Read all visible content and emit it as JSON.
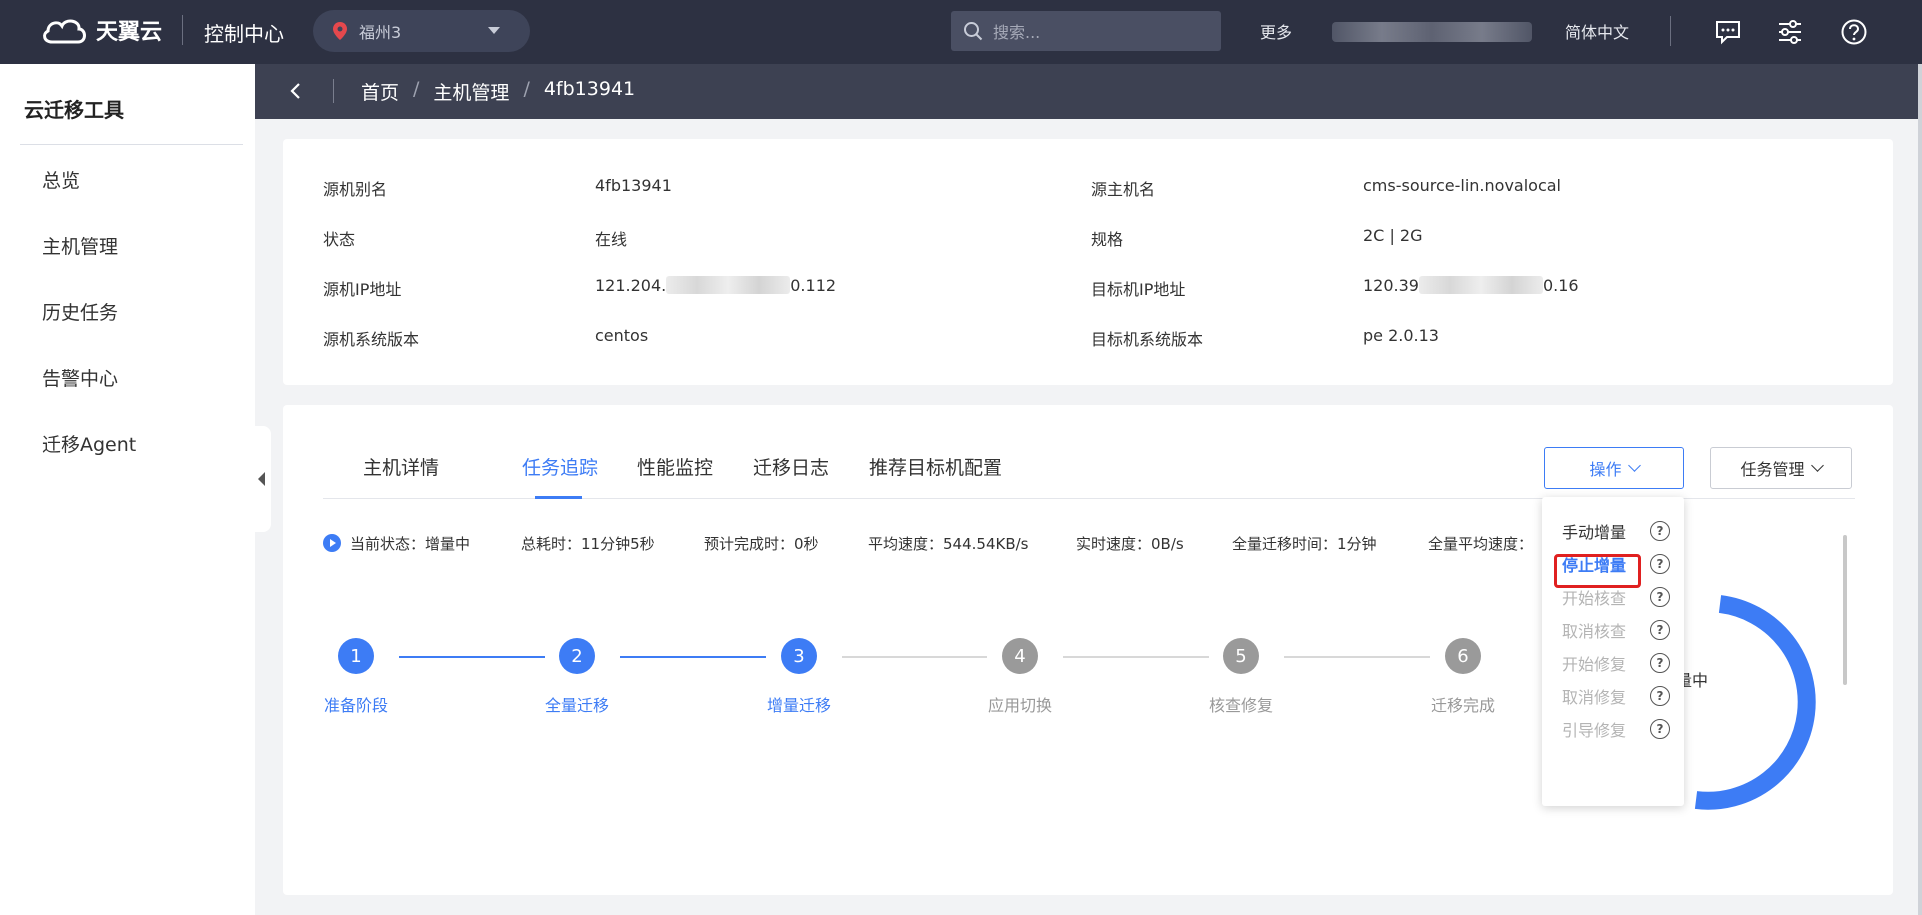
{
  "colors": {
    "accent": "#3d7cf5",
    "topbar": "#2d3142",
    "highlight_box": "#e02020"
  },
  "topbar": {
    "brand": "天翼云",
    "console": "控制中心",
    "region": "福州3",
    "search_placeholder": "搜索...",
    "more": "更多",
    "lang": "简体中文",
    "icons": [
      "message-icon",
      "settings-sliders-icon",
      "help-icon"
    ]
  },
  "sidebar": {
    "title": "云迁移工具",
    "items": [
      "总览",
      "主机管理",
      "历史任务",
      "告警中心",
      "迁移Agent"
    ]
  },
  "breadcrumb": {
    "items": [
      "首页",
      "主机管理",
      "4fb13941"
    ],
    "separator": "/"
  },
  "info": {
    "left": [
      {
        "label": "源机别名",
        "value": "4fb13941"
      },
      {
        "label": "状态",
        "value": "在线"
      },
      {
        "label": "源机IP地址",
        "value_prefix": "121.204.",
        "value_suffix": "0.112"
      },
      {
        "label": "源机系统版本",
        "value": "centos"
      }
    ],
    "right": [
      {
        "label": "源主机名",
        "value": "cms-source-lin.novalocal"
      },
      {
        "label": "规格",
        "value": "2C | 2G"
      },
      {
        "label": "目标机IP地址",
        "value_prefix": "120.39",
        "value_suffix": "0.16"
      },
      {
        "label": "目标机系统版本",
        "value": "pe 2.0.13"
      }
    ]
  },
  "tabs": [
    "主机详情",
    "任务追踪",
    "性能监控",
    "迁移日志",
    "推荐目标机配置"
  ],
  "active_tab": "任务追踪",
  "buttons": {
    "ops": "操作",
    "task": "任务管理"
  },
  "status": {
    "current": "当前状态：增量中",
    "total_time": "总耗时：11分钟5秒",
    "eta": "预计完成时：0秒",
    "avg_speed": "平均速度：544.54KB/s",
    "realtime_speed": "实时速度：0B/s",
    "full_time": "全量迁移时间：1分钟",
    "full_avg_speed": "全量平均速度："
  },
  "steps": [
    {
      "num": "1",
      "label": "准备阶段",
      "done": true
    },
    {
      "num": "2",
      "label": "全量迁移",
      "done": true
    },
    {
      "num": "3",
      "label": "增量迁移",
      "done": true
    },
    {
      "num": "4",
      "label": "应用切换",
      "done": false
    },
    {
      "num": "5",
      "label": "核查修复",
      "done": false
    },
    {
      "num": "6",
      "label": "迁移完成",
      "done": false
    }
  ],
  "donut_label_partial": "量中",
  "ops_menu": [
    {
      "label": "手动增量",
      "state": "enabled"
    },
    {
      "label": "停止增量",
      "state": "highlight"
    },
    {
      "label": "开始核查",
      "state": "disabled"
    },
    {
      "label": "取消核查",
      "state": "disabled"
    },
    {
      "label": "开始修复",
      "state": "disabled"
    },
    {
      "label": "取消修复",
      "state": "disabled"
    },
    {
      "label": "引导修复",
      "state": "disabled"
    }
  ],
  "help_glyph": "?"
}
